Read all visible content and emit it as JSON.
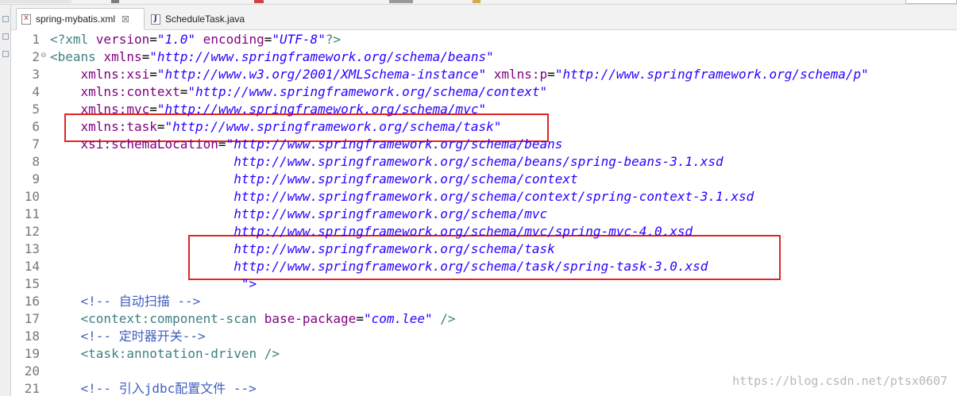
{
  "tabs": [
    {
      "label": "spring-mybatis.xml",
      "close": "☒",
      "icon": "xml-file-icon",
      "active": true
    },
    {
      "label": "ScheduleTask.java",
      "icon": "java-file-icon",
      "active": false
    }
  ],
  "lines": [
    {
      "num": "1",
      "tokens": [
        [
          "pi",
          "<?xml "
        ],
        [
          "attr",
          "version"
        ],
        [
          "",
          "="
        ],
        [
          "str",
          "\"1.0\""
        ],
        [
          "",
          ""
        ],
        [
          "attr",
          " encoding"
        ],
        [
          "",
          "="
        ],
        [
          "str",
          "\"UTF-8\""
        ],
        [
          "pi",
          "?>"
        ]
      ]
    },
    {
      "num": "2",
      "fold": "⊖",
      "tokens": [
        [
          "tag",
          "<beans "
        ],
        [
          "attr",
          "xmlns"
        ],
        [
          "",
          "="
        ],
        [
          "str",
          "\"http://www.springframework.org/schema/beans\""
        ]
      ]
    },
    {
      "num": "3",
      "tokens": [
        [
          "",
          "    "
        ],
        [
          "attr",
          "xmlns:xsi"
        ],
        [
          "",
          "="
        ],
        [
          "str",
          "\"http://www.w3.org/2001/XMLSchema-instance\""
        ],
        [
          "",
          " "
        ],
        [
          "attr",
          "xmlns:p"
        ],
        [
          "",
          "="
        ],
        [
          "str",
          "\"http://www.springframework.org/schema/p\""
        ]
      ]
    },
    {
      "num": "4",
      "tokens": [
        [
          "",
          "    "
        ],
        [
          "attr",
          "xmlns:context"
        ],
        [
          "",
          "="
        ],
        [
          "str",
          "\"http://www.springframework.org/schema/context\""
        ]
      ]
    },
    {
      "num": "5",
      "tokens": [
        [
          "",
          "    "
        ],
        [
          "attr",
          "xmlns:mvc"
        ],
        [
          "",
          "="
        ],
        [
          "str",
          "\"http://www.springframework.org/schema/mvc\""
        ]
      ]
    },
    {
      "num": "6",
      "tokens": [
        [
          "",
          "    "
        ],
        [
          "attr",
          "xmlns:task"
        ],
        [
          "",
          "="
        ],
        [
          "str",
          "\"http://www.springframework.org/schema/task\""
        ]
      ]
    },
    {
      "num": "7",
      "tokens": [
        [
          "",
          "    "
        ],
        [
          "attr",
          "xsi:schemaLocation"
        ],
        [
          "",
          "="
        ],
        [
          "str",
          "\"http://www.springframework.org/schema/beans"
        ]
      ]
    },
    {
      "num": "8",
      "tokens": [
        [
          "",
          "                        "
        ],
        [
          "str",
          "http://www.springframework.org/schema/beans/spring-beans-3.1.xsd"
        ]
      ]
    },
    {
      "num": "9",
      "tokens": [
        [
          "",
          "                        "
        ],
        [
          "str",
          "http://www.springframework.org/schema/context"
        ]
      ]
    },
    {
      "num": "10",
      "tokens": [
        [
          "",
          "                        "
        ],
        [
          "str",
          "http://www.springframework.org/schema/context/spring-context-3.1.xsd"
        ]
      ]
    },
    {
      "num": "11",
      "tokens": [
        [
          "",
          "                        "
        ],
        [
          "str",
          "http://www.springframework.org/schema/mvc"
        ]
      ]
    },
    {
      "num": "12",
      "tokens": [
        [
          "",
          "                        "
        ],
        [
          "str",
          "http://www.springframework.org/schema/mvc/spring-mvc-4.0.xsd"
        ]
      ]
    },
    {
      "num": "13",
      "tokens": [
        [
          "",
          "                        "
        ],
        [
          "str",
          "http://www.springframework.org/schema/task"
        ]
      ]
    },
    {
      "num": "14",
      "tokens": [
        [
          "",
          "                        "
        ],
        [
          "str",
          "http://www.springframework.org/schema/task/spring-task-3.0.xsd"
        ]
      ]
    },
    {
      "num": "",
      "tokens": [
        [
          "",
          "                         "
        ],
        [
          "str",
          "\">"
        ]
      ]
    },
    {
      "num": "16",
      "tokens": [
        [
          "",
          "    "
        ],
        [
          "cmt",
          "<!-- 自动扫描 -->"
        ]
      ]
    },
    {
      "num": "17",
      "tokens": [
        [
          "",
          "    "
        ],
        [
          "tag",
          "<context:component-scan "
        ],
        [
          "attr",
          "base-package"
        ],
        [
          "",
          "="
        ],
        [
          "str",
          "\"com.lee\""
        ],
        [
          "tag",
          " />"
        ]
      ]
    },
    {
      "num": "18",
      "tokens": [
        [
          "",
          "    "
        ],
        [
          "cmt",
          "<!-- 定时器开关-->"
        ]
      ]
    },
    {
      "num": "19",
      "tokens": [
        [
          "",
          "    "
        ],
        [
          "tag",
          "<task:annotation-driven />"
        ]
      ]
    },
    {
      "num": "20",
      "tokens": []
    },
    {
      "num": "21",
      "tokens": [
        [
          "",
          "    "
        ],
        [
          "cmt",
          "<!-- 引入jdbc配置文件 -->"
        ]
      ]
    }
  ],
  "line15_num": "15",
  "watermark": "https://blog.csdn.net/ptsx0607",
  "colors": {
    "highlight": "#e02424",
    "tag": "#3f7f7f",
    "attr": "#7f007f",
    "string": "#2a00ff",
    "comment": "#3f5fbf"
  }
}
